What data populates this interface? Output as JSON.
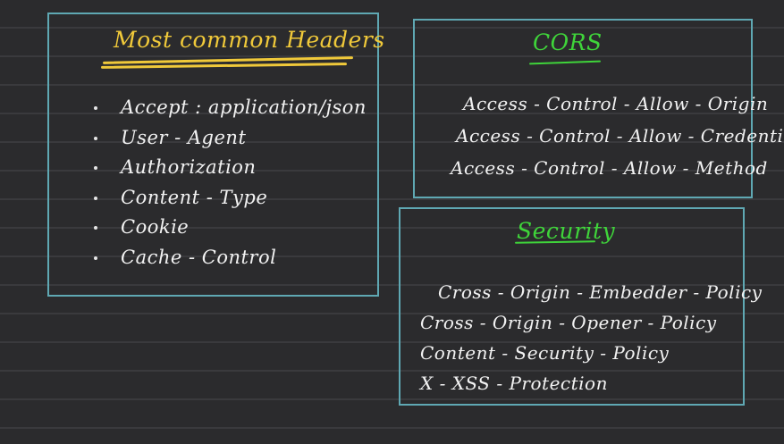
{
  "headers_panel": {
    "title": "Most common Headers",
    "items": [
      "Accept : application/json",
      "User - Agent",
      "Authorization",
      "Content - Type",
      "Cookie",
      "Cache - Control"
    ]
  },
  "cors_panel": {
    "title": "CORS",
    "items": [
      "Access - Control - Allow - Origin",
      "Access - Control - Allow - Credentials",
      "Access - Control - Allow - Method"
    ]
  },
  "security_panel": {
    "title": "Security",
    "items": [
      "Cross - Origin - Embedder - Policy",
      "Cross - Origin - Opener - Policy",
      "Content - Security - Policy",
      "X - XSS - Protection"
    ]
  },
  "colors": {
    "background": "#2b2b2d",
    "panel_border": "#5fa8b3",
    "title_yellow": "#f0c93a",
    "title_green": "#3fd43a",
    "text": "#f2f2f2"
  }
}
